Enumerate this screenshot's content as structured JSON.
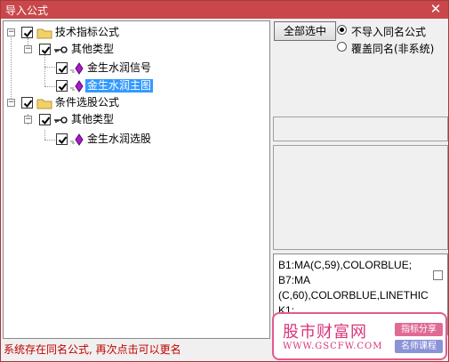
{
  "window": {
    "title": "导入公式",
    "close_glyph": "✕"
  },
  "tree": [
    {
      "label": "技术指标公式",
      "expander": "−",
      "checked": true,
      "icon": "folder-icon",
      "level": 0
    },
    {
      "label": "其他类型",
      "expander": "−",
      "checked": true,
      "icon": "key-icon",
      "level": 1
    },
    {
      "label": "金生水润信号",
      "checked": true,
      "icon": "diamond-icon",
      "level": 2,
      "selected": false
    },
    {
      "label": "金生水润主图",
      "checked": true,
      "icon": "diamond-icon",
      "level": 2,
      "selected": true
    },
    {
      "label": "条件选股公式",
      "expander": "−",
      "checked": true,
      "icon": "folder-icon",
      "level": 0
    },
    {
      "label": "其他类型",
      "expander": "−",
      "checked": true,
      "icon": "key-icon",
      "level": 1
    },
    {
      "label": "金生水润选股",
      "checked": true,
      "icon": "diamond-icon",
      "level": 2,
      "selected": false
    }
  ],
  "controls": {
    "select_all_label": "全部选中",
    "radio_no_import": "不导入同名公式",
    "radio_overwrite": "覆盖同名(非系统)",
    "selected_radio": "no_import"
  },
  "code_preview": {
    "text": "B1:MA(C,59),COLORBLUE;\nB7:MA\n(C,60),COLORBLUE,LINETHIC\nK1;"
  },
  "status": {
    "message": "系统存在同名公式, 再次点击可以更名"
  },
  "watermark": {
    "title": "股市财富网",
    "url": "WWW.GSCFW.COM",
    "tag1": "指标分享",
    "tag2": "名师课程"
  },
  "colors": {
    "titlebar": "#c9474a",
    "selection": "#3399ff",
    "status_text": "#c00000",
    "diamond": "#a020c0",
    "folder": "#f2d16b",
    "watermark": "#d8357a"
  }
}
